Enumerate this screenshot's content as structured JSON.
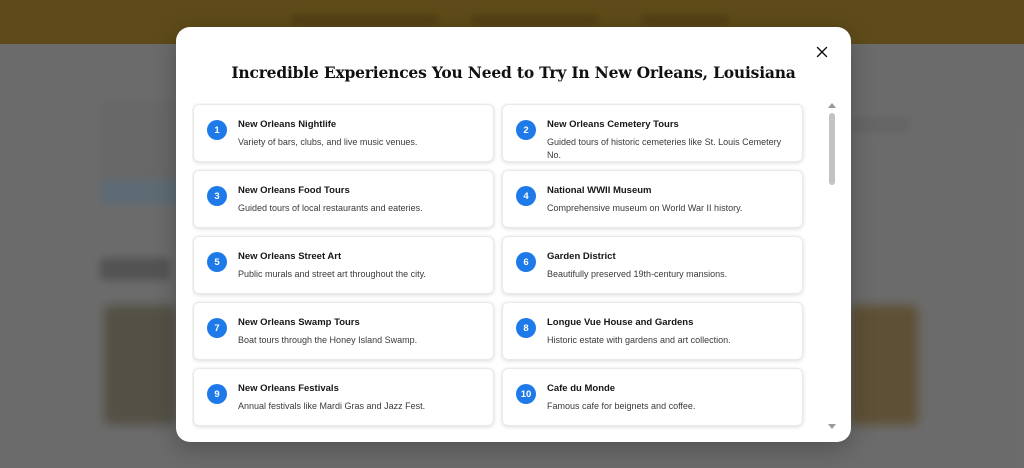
{
  "modal": {
    "title": "Incredible Experiences You Need to Try In New Orleans, Louisiana",
    "close_label": "X"
  },
  "experiences": [
    {
      "number": "1",
      "title": "New Orleans Nightlife",
      "description": "Variety of bars, clubs, and live music venues."
    },
    {
      "number": "2",
      "title": "New Orleans Cemetery Tours",
      "description": "Guided tours of historic cemeteries like St. Louis Cemetery No."
    },
    {
      "number": "3",
      "title": "New Orleans Food Tours",
      "description": "Guided tours of local restaurants and eateries."
    },
    {
      "number": "4",
      "title": "National WWII Museum",
      "description": "Comprehensive museum on World War II history."
    },
    {
      "number": "5",
      "title": "New Orleans Street Art",
      "description": "Public murals and street art throughout the city."
    },
    {
      "number": "6",
      "title": "Garden District",
      "description": "Beautifully preserved 19th-century mansions."
    },
    {
      "number": "7",
      "title": "New Orleans Swamp Tours",
      "description": "Boat tours through the Honey Island Swamp."
    },
    {
      "number": "8",
      "title": "Longue Vue House and Gardens",
      "description": "Historic estate with gardens and art collection."
    },
    {
      "number": "9",
      "title": "New Orleans Festivals",
      "description": "Annual festivals like Mardi Gras and Jazz Fest."
    },
    {
      "number": "10",
      "title": "Cafe du Monde",
      "description": "Famous cafe for beignets and coffee."
    }
  ],
  "colors": {
    "badge": "#1f7ae9",
    "header_bar": "#6b5416",
    "backdrop": "#7b7b7b"
  },
  "icons": {
    "close": "close-icon",
    "scroll_up": "scroll-up-arrow-icon",
    "scroll_down": "scroll-down-arrow-icon"
  }
}
